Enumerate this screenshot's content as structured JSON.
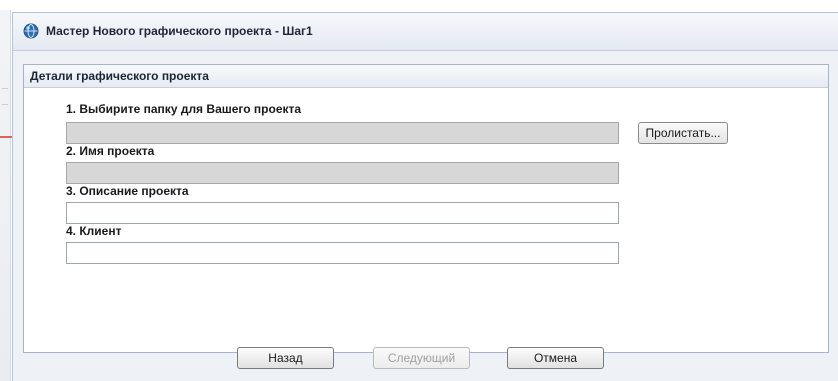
{
  "window": {
    "title": "Мастер Нового графического проекта - Шаг1",
    "icon": "app-globe-icon"
  },
  "panel": {
    "header": "Детали графического проекта"
  },
  "fields": [
    {
      "label": "1. Выбирите папку для Вашего проекта",
      "value": "",
      "enabled": false
    },
    {
      "label": "2. Имя проекта",
      "value": "",
      "enabled": false
    },
    {
      "label": "3. Описание проекта",
      "value": "",
      "enabled": true
    },
    {
      "label": "4. Клиент",
      "value": "",
      "enabled": true
    }
  ],
  "browse_button": {
    "label": "Пролистать..."
  },
  "footer": {
    "back_label": "Назад",
    "next_label": "Следующий",
    "next_enabled": false,
    "cancel_label": "Отмена"
  },
  "colors": {
    "annotation_arrow": "#d9342b",
    "disabled_field": "#d7d7d7",
    "title_bar": "#e4e9f1"
  }
}
